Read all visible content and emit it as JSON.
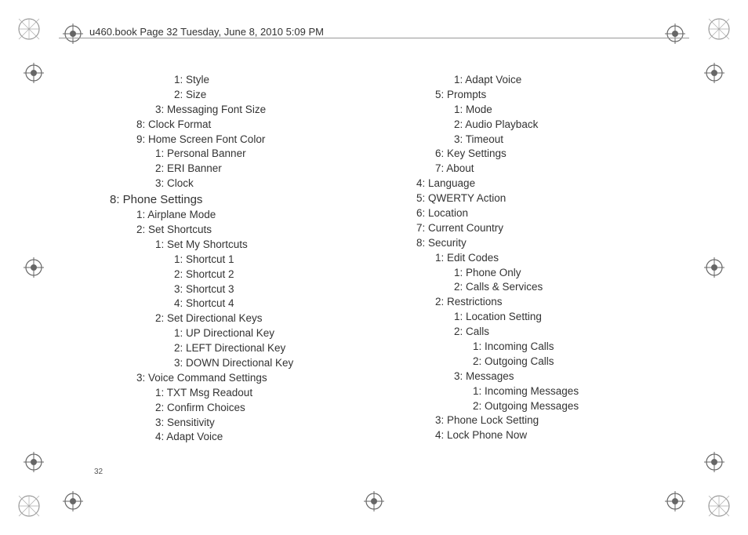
{
  "header": "u460.book  Page 32  Tuesday, June 8, 2010  5:09 PM",
  "pageNumber": "32",
  "left": [
    {
      "lvl": 3,
      "t": "1: Style"
    },
    {
      "lvl": 3,
      "t": "2: Size"
    },
    {
      "lvl": 2,
      "t": "3: Messaging Font Size"
    },
    {
      "lvl": 1,
      "t": "8: Clock Format"
    },
    {
      "lvl": 1,
      "t": "9: Home Screen Font Color"
    },
    {
      "lvl": 2,
      "t": "1: Personal Banner"
    },
    {
      "lvl": 2,
      "t": "2: ERI Banner"
    },
    {
      "lvl": 2,
      "t": "3: Clock"
    },
    {
      "lvl": 0,
      "t": "8: Phone Settings"
    },
    {
      "lvl": 1,
      "t": "1: Airplane Mode"
    },
    {
      "lvl": 1,
      "t": "2: Set Shortcuts"
    },
    {
      "lvl": 2,
      "t": "1: Set My Shortcuts"
    },
    {
      "lvl": 3,
      "t": "1: Shortcut 1"
    },
    {
      "lvl": 3,
      "t": "2: Shortcut 2"
    },
    {
      "lvl": 3,
      "t": "3: Shortcut 3"
    },
    {
      "lvl": 3,
      "t": "4: Shortcut 4"
    },
    {
      "lvl": 2,
      "t": "2: Set Directional Keys"
    },
    {
      "lvl": 3,
      "t": "1: UP Directional Key"
    },
    {
      "lvl": 3,
      "t": "2: LEFT Directional Key"
    },
    {
      "lvl": 3,
      "t": "3: DOWN Directional Key"
    },
    {
      "lvl": 1,
      "t": "3: Voice Command Settings"
    },
    {
      "lvl": 2,
      "t": "1: TXT Msg Readout"
    },
    {
      "lvl": 2,
      "t": "2: Confirm Choices"
    },
    {
      "lvl": 2,
      "t": "3: Sensitivity"
    },
    {
      "lvl": 2,
      "t": "4: Adapt Voice"
    }
  ],
  "right": [
    {
      "lvl": 3,
      "t": "1: Adapt Voice"
    },
    {
      "lvl": 2,
      "t": "5: Prompts"
    },
    {
      "lvl": 3,
      "t": "1: Mode"
    },
    {
      "lvl": 3,
      "t": "2: Audio Playback"
    },
    {
      "lvl": 3,
      "t": "3: Timeout"
    },
    {
      "lvl": 2,
      "t": "6: Key Settings"
    },
    {
      "lvl": 2,
      "t": "7: About"
    },
    {
      "lvl": 1,
      "t": "4: Language"
    },
    {
      "lvl": 1,
      "t": "5: QWERTY Action"
    },
    {
      "lvl": 1,
      "t": "6: Location"
    },
    {
      "lvl": 1,
      "t": "7: Current Country"
    },
    {
      "lvl": 1,
      "t": "8: Security"
    },
    {
      "lvl": 2,
      "t": "1: Edit Codes"
    },
    {
      "lvl": 3,
      "t": "1: Phone Only"
    },
    {
      "lvl": 3,
      "t": "2: Calls & Services"
    },
    {
      "lvl": 2,
      "t": "2: Restrictions"
    },
    {
      "lvl": 3,
      "t": "1: Location Setting"
    },
    {
      "lvl": 3,
      "t": "2: Calls"
    },
    {
      "lvl": 4,
      "t": "1: Incoming Calls"
    },
    {
      "lvl": 4,
      "t": "2: Outgoing Calls"
    },
    {
      "lvl": 3,
      "t": "3: Messages"
    },
    {
      "lvl": 4,
      "t": "1: Incoming Messages"
    },
    {
      "lvl": 4,
      "t": "2: Outgoing Messages"
    },
    {
      "lvl": 2,
      "t": "3: Phone Lock Setting"
    },
    {
      "lvl": 2,
      "t": "4: Lock Phone Now"
    }
  ]
}
